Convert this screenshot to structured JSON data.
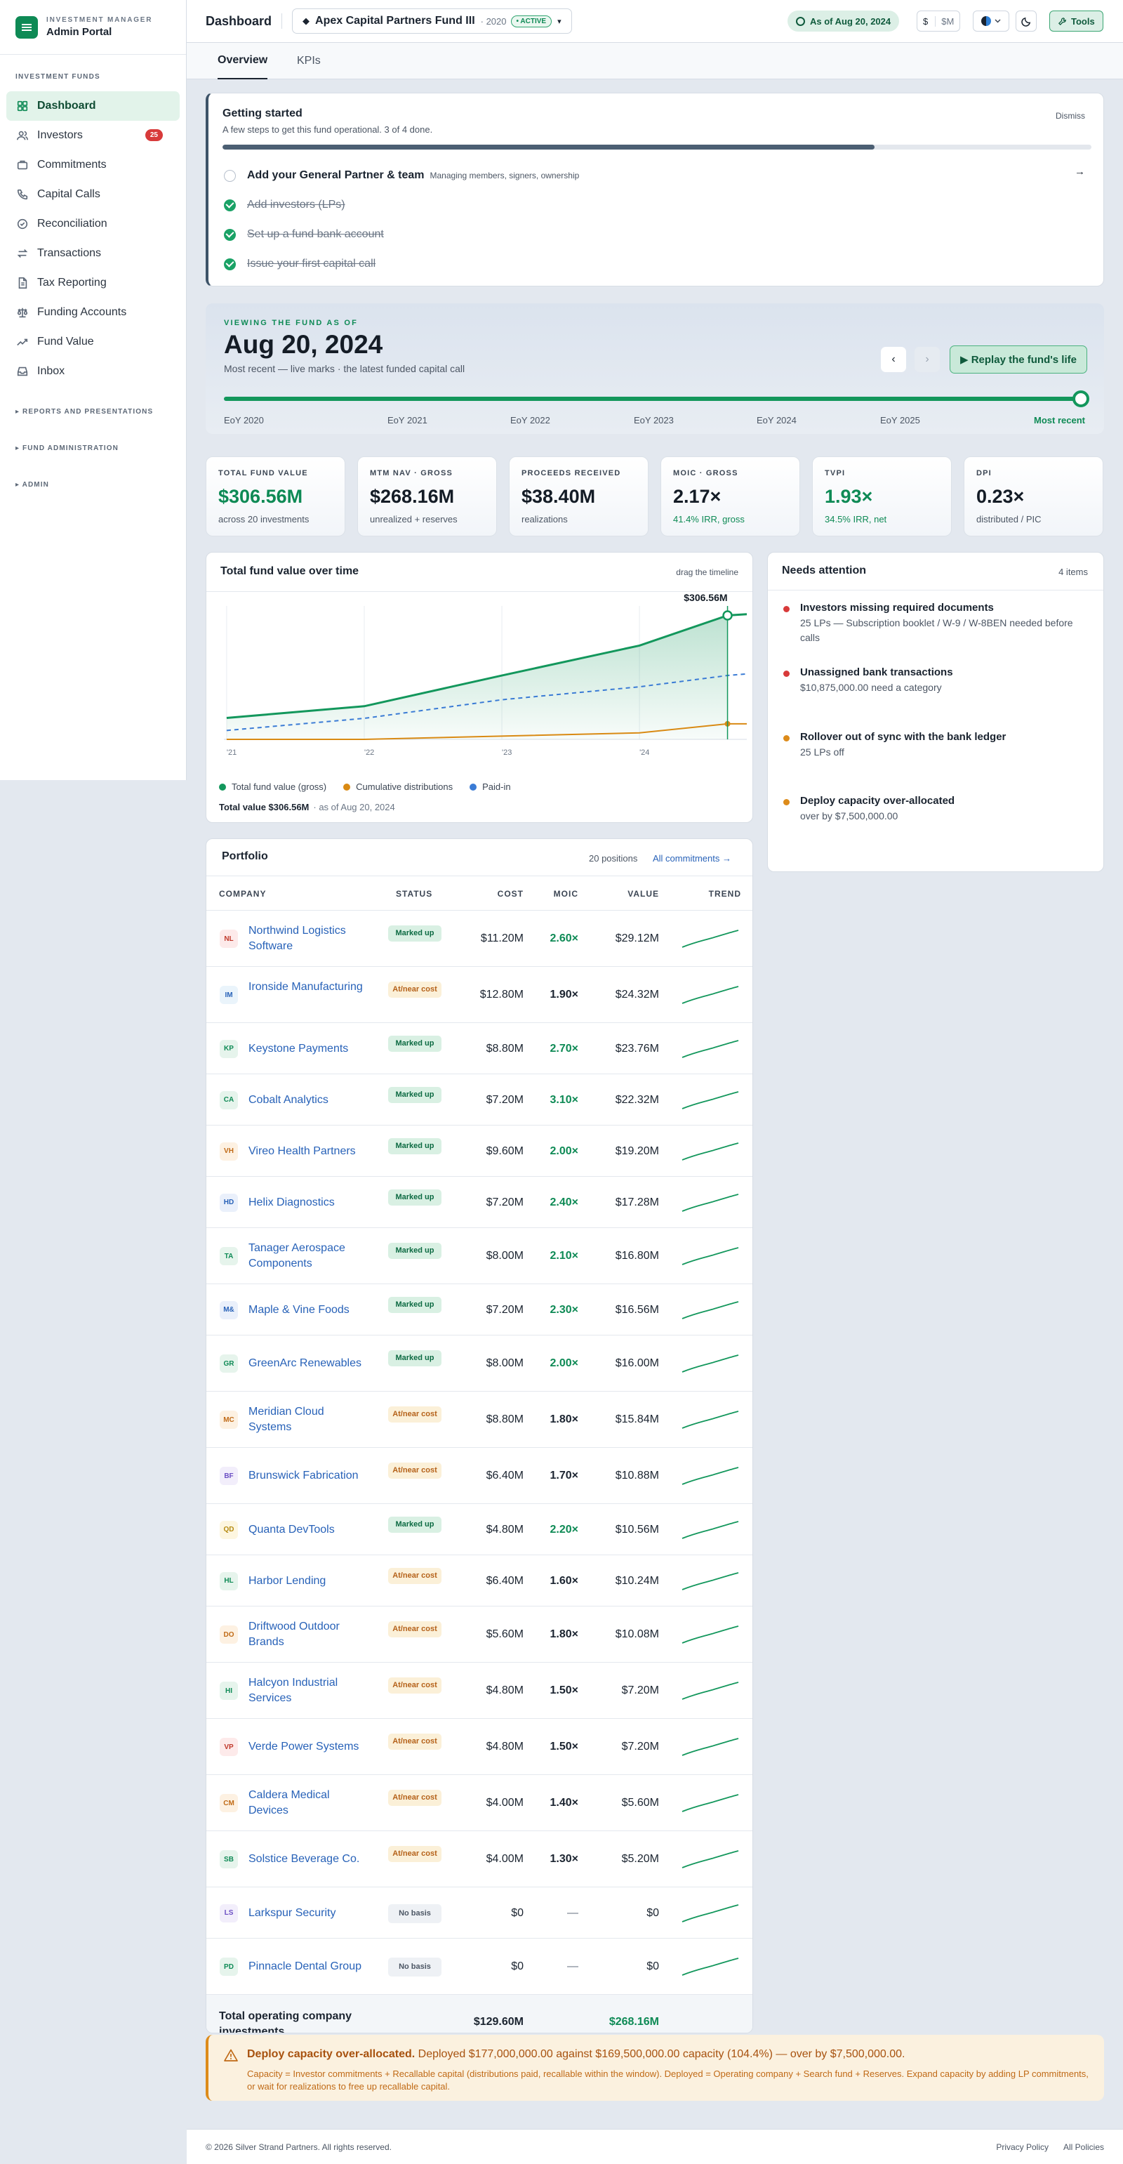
{
  "brand": {
    "sub": "INVESTMENT MANAGER",
    "name": "Admin Portal"
  },
  "sidebar": {
    "section": "INVESTMENT FUNDS",
    "items": [
      {
        "label": "Dashboard",
        "icon": "grid-icon",
        "active": true
      },
      {
        "label": "Investors",
        "icon": "users-icon",
        "badge": "25"
      },
      {
        "label": "Commitments",
        "icon": "handshake-icon"
      },
      {
        "label": "Capital Calls",
        "icon": "phone-icon"
      },
      {
        "label": "Reconciliation",
        "icon": "check-circle-icon"
      },
      {
        "label": "Transactions",
        "icon": "swap-icon"
      },
      {
        "label": "Tax Reporting",
        "icon": "document-icon"
      },
      {
        "label": "Funding Accounts",
        "icon": "scale-icon"
      },
      {
        "label": "Fund Value",
        "icon": "trend-icon"
      },
      {
        "label": "Inbox",
        "icon": "inbox-icon"
      }
    ],
    "groups": [
      "▸ REPORTS AND PRESENTATIONS",
      "▸ FUND ADMINISTRATION",
      "▸ ADMIN"
    ]
  },
  "header": {
    "title": "Dashboard",
    "fund_name": "Apex Capital Partners Fund III",
    "fund_year": "· 2020",
    "fund_status": "• ACTIVE",
    "as_of": "As of Aug 20, 2024",
    "unit_on": "$",
    "unit_off": "$M",
    "tools": "Tools"
  },
  "tabs": [
    {
      "label": "Overview",
      "active": true
    },
    {
      "label": "KPIs"
    }
  ],
  "getting_started": {
    "title": "Getting started",
    "subtitle": "A few steps to get this fund operational. 3 of 4 done.",
    "dismiss": "Dismiss",
    "progress": 0.75,
    "steps": [
      {
        "label": "Add your General Partner & team",
        "hint": "Managing members, signers, ownership",
        "done": false
      },
      {
        "label": "Add investors (LPs)",
        "done": true
      },
      {
        "label": "Set up a fund bank account",
        "done": true
      },
      {
        "label": "Issue your first capital call",
        "done": true
      }
    ],
    "arrow": "→"
  },
  "timeline": {
    "kicker": "VIEWING THE FUND AS OF",
    "date": "Aug 20, 2024",
    "subtitle": "Most recent — live marks · the latest funded capital call",
    "prev": "‹",
    "next": "›",
    "replay": "▶ Replay the fund's life",
    "position": 1.0,
    "labels": [
      "EoY 2020",
      "EoY 2021",
      "EoY 2022",
      "EoY 2023",
      "EoY 2024",
      "EoY 2025",
      "Most recent"
    ]
  },
  "kpis": [
    {
      "label": "TOTAL FUND VALUE",
      "value": "$306.56M",
      "sub": "across 20 investments",
      "green": true,
      "sub_green": false
    },
    {
      "label": "MTM NAV · GROSS",
      "value": "$268.16M",
      "sub": "unrealized + reserves",
      "green": false,
      "sub_green": false
    },
    {
      "label": "PROCEEDS RECEIVED",
      "value": "$38.40M",
      "sub": "realizations",
      "green": false,
      "sub_green": false
    },
    {
      "label": "MOIC · GROSS",
      "value": "2.17×",
      "sub": "41.4% IRR, gross",
      "green": false,
      "sub_green": true
    },
    {
      "label": "TVPI",
      "value": "1.93×",
      "sub": "34.5% IRR, net",
      "green": true,
      "sub_green": true
    },
    {
      "label": "DPI",
      "value": "0.23×",
      "sub": "distributed / PIC",
      "green": false,
      "sub_green": false
    }
  ],
  "chart": {
    "title": "Total fund value over time",
    "hint": "drag the timeline",
    "total_label": "Total value $306.56M",
    "as_of": "· as of Aug 20, 2024"
  },
  "chart_data": {
    "type": "area",
    "x": [
      2021.0,
      2022.0,
      2023.0,
      2024.0,
      2024.64
    ],
    "xticks": [
      "'21",
      "'22",
      "'23",
      "'24"
    ],
    "ylim": [
      0,
      330
    ],
    "end_label": "$306.56M",
    "series": [
      {
        "name": "Total fund value (gross)",
        "color": "#13975c",
        "values": [
          53,
          82,
          158,
          232,
          306.56
        ]
      },
      {
        "name": "Cumulative distributions",
        "color": "#d98a14",
        "values": [
          0,
          0,
          8,
          16,
          38.4
        ]
      },
      {
        "name": "Paid-in",
        "color": "#3a7bd5",
        "values": [
          22,
          52,
          98,
          130,
          158
        ],
        "dashed": true
      }
    ]
  },
  "attention": {
    "title": "Needs attention",
    "count": "4 items",
    "items": [
      {
        "title": "Investors missing required documents",
        "desc": "25 LPs — Subscription booklet / W-9 / W-8BEN needed before calls",
        "color": "#d83a3a"
      },
      {
        "title": "Unassigned bank transactions",
        "desc": "$10,875,000.00 need a category",
        "color": "#d83a3a"
      },
      {
        "title": "Rollover out of sync with the bank ledger",
        "desc": "25 LPs off",
        "color": "#dd8b1a"
      },
      {
        "title": "Deploy capacity over-allocated",
        "desc": "over by $7,500,000.00",
        "color": "#dd8b1a"
      }
    ]
  },
  "portfolio": {
    "title": "Portfolio",
    "count": "20 positions",
    "link": "All commitments →",
    "columns": [
      "COMPANY",
      "STATUS",
      "COST",
      "MOIC",
      "VALUE",
      "TREND"
    ],
    "rows": [
      {
        "abbr": "NL",
        "name": "Northwind Logistics Software",
        "status": "Marked up",
        "kind": "mu",
        "cost": "$11.20M",
        "moic": "2.60×",
        "value": "$29.12M"
      },
      {
        "abbr": "IM",
        "name": "Ironside Manufacturing",
        "status": "At/near cost",
        "kind": "ac",
        "cost": "$12.80M",
        "moic": "1.90×",
        "value": "$24.32M"
      },
      {
        "abbr": "KP",
        "name": "Keystone Payments",
        "status": "Marked up",
        "kind": "mu",
        "cost": "$8.80M",
        "moic": "2.70×",
        "value": "$23.76M"
      },
      {
        "abbr": "CA",
        "name": "Cobalt Analytics",
        "status": "Marked up",
        "kind": "mu",
        "cost": "$7.20M",
        "moic": "3.10×",
        "value": "$22.32M"
      },
      {
        "abbr": "VH",
        "name": "Vireo Health Partners",
        "status": "Marked up",
        "kind": "mu",
        "cost": "$9.60M",
        "moic": "2.00×",
        "value": "$19.20M"
      },
      {
        "abbr": "HD",
        "name": "Helix Diagnostics",
        "status": "Marked up",
        "kind": "mu",
        "cost": "$7.20M",
        "moic": "2.40×",
        "value": "$17.28M"
      },
      {
        "abbr": "TA",
        "name": "Tanager Aerospace Components",
        "status": "Marked up",
        "kind": "mu",
        "cost": "$8.00M",
        "moic": "2.10×",
        "value": "$16.80M"
      },
      {
        "abbr": "M&",
        "name": "Maple & Vine Foods",
        "status": "Marked up",
        "kind": "mu",
        "cost": "$7.20M",
        "moic": "2.30×",
        "value": "$16.56M"
      },
      {
        "abbr": "GR",
        "name": "GreenArc Renewables",
        "status": "Marked up",
        "kind": "mu",
        "cost": "$8.00M",
        "moic": "2.00×",
        "value": "$16.00M"
      },
      {
        "abbr": "MC",
        "name": "Meridian Cloud Systems",
        "status": "At/near cost",
        "kind": "ac",
        "cost": "$8.80M",
        "moic": "1.80×",
        "value": "$15.84M"
      },
      {
        "abbr": "BF",
        "name": "Brunswick Fabrication",
        "status": "At/near cost",
        "kind": "ac",
        "cost": "$6.40M",
        "moic": "1.70×",
        "value": "$10.88M"
      },
      {
        "abbr": "QD",
        "name": "Quanta DevTools",
        "status": "Marked up",
        "kind": "mu",
        "cost": "$4.80M",
        "moic": "2.20×",
        "value": "$10.56M"
      },
      {
        "abbr": "HL",
        "name": "Harbor Lending",
        "status": "At/near cost",
        "kind": "ac",
        "cost": "$6.40M",
        "moic": "1.60×",
        "value": "$10.24M"
      },
      {
        "abbr": "DO",
        "name": "Driftwood Outdoor Brands",
        "status": "At/near cost",
        "kind": "ac",
        "cost": "$5.60M",
        "moic": "1.80×",
        "value": "$10.08M"
      },
      {
        "abbr": "HI",
        "name": "Halcyon Industrial Services",
        "status": "At/near cost",
        "kind": "ac",
        "cost": "$4.80M",
        "moic": "1.50×",
        "value": "$7.20M"
      },
      {
        "abbr": "VP",
        "name": "Verde Power Systems",
        "status": "At/near cost",
        "kind": "ac",
        "cost": "$4.80M",
        "moic": "1.50×",
        "value": "$7.20M"
      },
      {
        "abbr": "CM",
        "name": "Caldera Medical Devices",
        "status": "At/near cost",
        "kind": "ac",
        "cost": "$4.00M",
        "moic": "1.40×",
        "value": "$5.60M"
      },
      {
        "abbr": "SB",
        "name": "Solstice Beverage Co.",
        "status": "At/near cost",
        "kind": "ac",
        "cost": "$4.00M",
        "moic": "1.30×",
        "value": "$5.20M"
      },
      {
        "abbr": "LS",
        "name": "Larkspur Security",
        "status": "No basis",
        "kind": "nb",
        "cost": "$0",
        "moic": "—",
        "value": "$0"
      },
      {
        "abbr": "PD",
        "name": "Pinnacle Dental Group",
        "status": "No basis",
        "kind": "nb",
        "cost": "$0",
        "moic": "—",
        "value": "$0"
      }
    ],
    "total_label": "Total operating company investments",
    "total_cost": "$129.60M",
    "total_value": "$268.16M"
  },
  "warning": {
    "title_bold": "Deploy capacity over-allocated.",
    "title_rest": " Deployed $177,000,000.00 against $169,500,000.00 capacity (104.4%) — over by $7,500,000.00.",
    "body": "Capacity = Investor commitments + Recallable capital (distributions paid, recallable within the window). Deployed = Operating company + Search fund + Reserves. Expand capacity by adding LP commitments, or wait for realizations to free up recallable capital."
  },
  "footer": {
    "copy": "© 2026 Silver Strand Partners. All rights reserved.",
    "privacy": "Privacy Policy",
    "policies": "All Policies"
  },
  "colors": {
    "accent": "#0e8a55",
    "danger": "#d83a3a",
    "warning": "#dd8b1a",
    "link": "#2862b8"
  }
}
